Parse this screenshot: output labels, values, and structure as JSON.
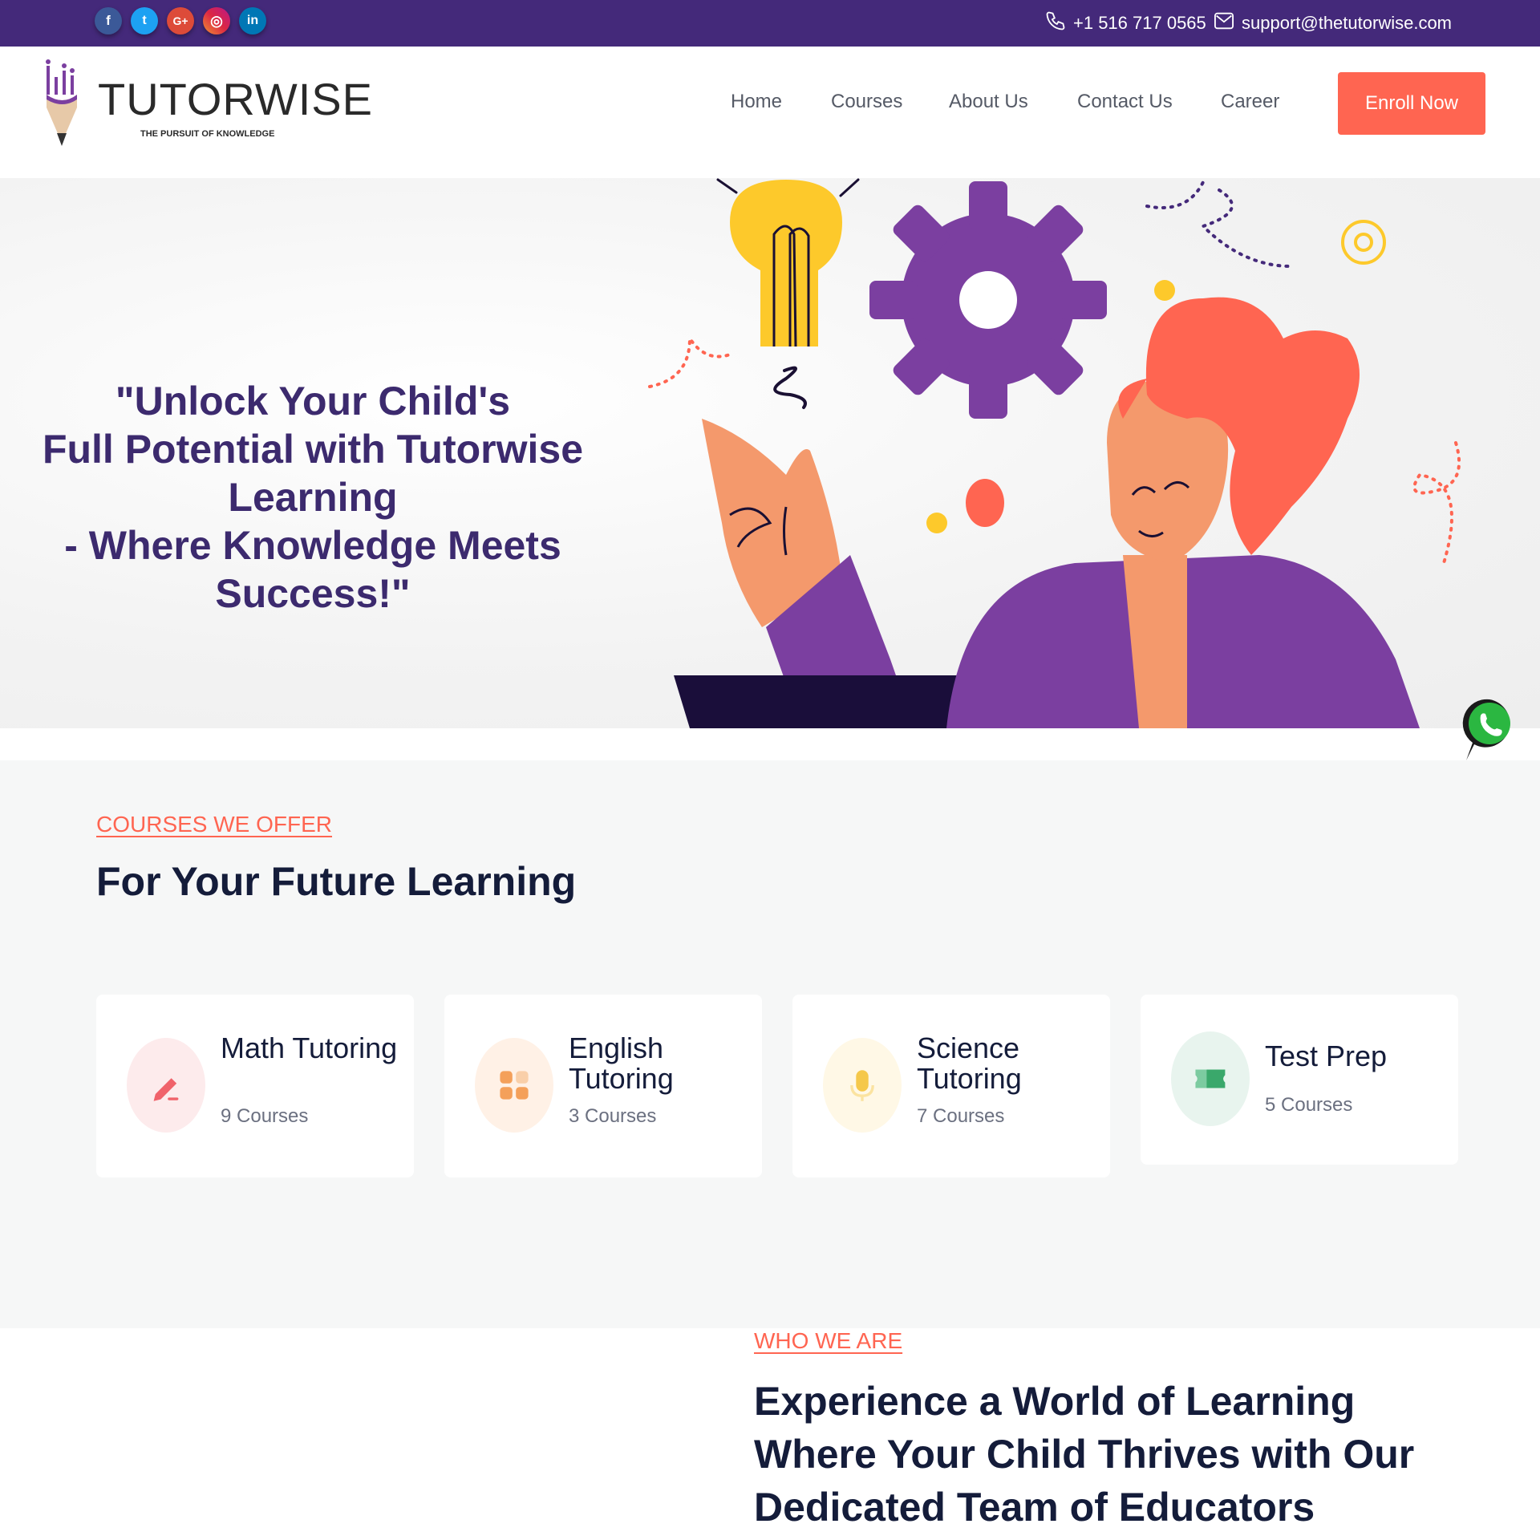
{
  "topbar": {
    "social": [
      {
        "name": "facebook",
        "glyph": "f",
        "color": "#3b5998"
      },
      {
        "name": "twitter",
        "glyph": "t",
        "color": "#1da1f2"
      },
      {
        "name": "google-plus",
        "glyph": "G+",
        "color": "#dd4b39"
      },
      {
        "name": "instagram",
        "glyph": "◎",
        "color": "#d6249f"
      },
      {
        "name": "linkedin",
        "glyph": "in",
        "color": "#0077b5"
      }
    ],
    "phone": "+1 516 717 0565",
    "email": "support@thetutorwise.com"
  },
  "header": {
    "logo_name": "TUTORWISE",
    "logo_tagline": "THE PURSUIT OF KNOWLEDGE",
    "nav": [
      "Home",
      "Courses",
      "About Us",
      "Contact Us",
      "Career"
    ],
    "cta": "Enroll Now"
  },
  "hero": {
    "line1": "\"Unlock Your Child's",
    "line2": "Full Potential with Tutorwise Learning",
    "line3": "- Where Knowledge Meets Success!\""
  },
  "courses": {
    "eyebrow": "COURSES WE OFFER",
    "title": "For Your Future Learning",
    "cards": [
      {
        "title": "Math Tutoring",
        "count": "9 Courses",
        "icon": "pencil-icon",
        "tint": "#fdebec",
        "accent": "#f0626a"
      },
      {
        "title": "English Tutoring",
        "count": "3 Courses",
        "icon": "grid-icon",
        "tint": "#fff1e6",
        "accent": "#f4a05a"
      },
      {
        "title": "Science Tutoring",
        "count": "7 Courses",
        "icon": "microphone-icon",
        "tint": "#fff8e6",
        "accent": "#f5c84a"
      },
      {
        "title": "Test Prep",
        "count": "5 Courses",
        "icon": "ticket-icon",
        "tint": "#e8f4ee",
        "accent": "#3aa86b"
      }
    ]
  },
  "who": {
    "eyebrow": "WHO WE ARE",
    "title": "Experience a World of Learning Where Your Child Thrives with Our Dedicated Team of Educators"
  },
  "colors": {
    "brand_purple": "#44297a",
    "accent_coral": "#ff6551",
    "heading_navy": "#141c3a",
    "hero_text": "#3c2a6e"
  }
}
